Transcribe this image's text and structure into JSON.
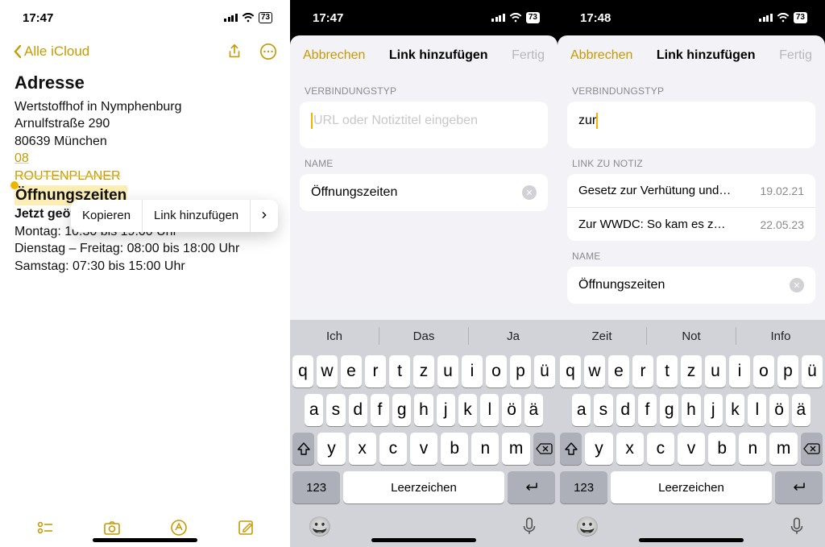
{
  "phone_a": {
    "status": {
      "time": "17:47",
      "battery": "73"
    },
    "nav": {
      "back_label": "Alle iCloud"
    },
    "note": {
      "title": "Adresse",
      "line1": "Wertstoffhof in Nymphenburg",
      "line2": "Arnulfstraße 290",
      "line3": "80639 München",
      "link08": "08",
      "routenplaner": "ROUTENPLANER",
      "oeff_heading": "Öffnungszeiten",
      "jetzt": "Jetzt geöffnet",
      "mo": "Montag: 10:30 bis 19:00 Uhr",
      "di_fr": "Dienstag – Freitag: 08:00 bis 18:00 Uhr",
      "sa": "Samstag: 07:30 bis 15:00 Uhr"
    },
    "context_menu": {
      "copy": "Kopieren",
      "add_link": "Link hinzufügen"
    }
  },
  "phone_b": {
    "status": {
      "time": "17:47",
      "battery": "73"
    },
    "sheet": {
      "cancel": "Abbrechen",
      "title": "Link hinzufügen",
      "done": "Fertig",
      "verbindungstyp_label": "VERBINDUNGSTYP",
      "url_placeholder": "URL oder Notiztitel eingeben",
      "name_label": "NAME",
      "name_value": "Öffnungszeiten"
    },
    "suggestions": [
      "Ich",
      "Das",
      "Ja"
    ],
    "space_label": "Leerzeichen",
    "num_label": "123"
  },
  "phone_c": {
    "status": {
      "time": "17:48",
      "battery": "73"
    },
    "sheet": {
      "cancel": "Abbrechen",
      "title": "Link hinzufügen",
      "done": "Fertig",
      "verbindungstyp_label": "VERBINDUNGSTYP",
      "url_value": "zur",
      "link_zu_notiz_label": "LINK ZU NOTIZ",
      "results": [
        {
          "title": "Gesetz zur Verhütung und B…",
          "date": "19.02.21"
        },
        {
          "title": "Zur WWDC:   So kam es zu…",
          "date": "22.05.23"
        }
      ],
      "name_label": "NAME",
      "name_value": "Öffnungszeiten"
    },
    "suggestions": [
      "Zeit",
      "Not",
      "Info"
    ],
    "space_label": "Leerzeichen",
    "num_label": "123"
  },
  "kb_rows": {
    "r1": [
      "q",
      "w",
      "e",
      "r",
      "t",
      "z",
      "u",
      "i",
      "o",
      "p",
      "ü"
    ],
    "r2": [
      "a",
      "s",
      "d",
      "f",
      "g",
      "h",
      "j",
      "k",
      "l",
      "ö",
      "ä"
    ],
    "r3": [
      "y",
      "x",
      "c",
      "v",
      "b",
      "n",
      "m"
    ]
  }
}
